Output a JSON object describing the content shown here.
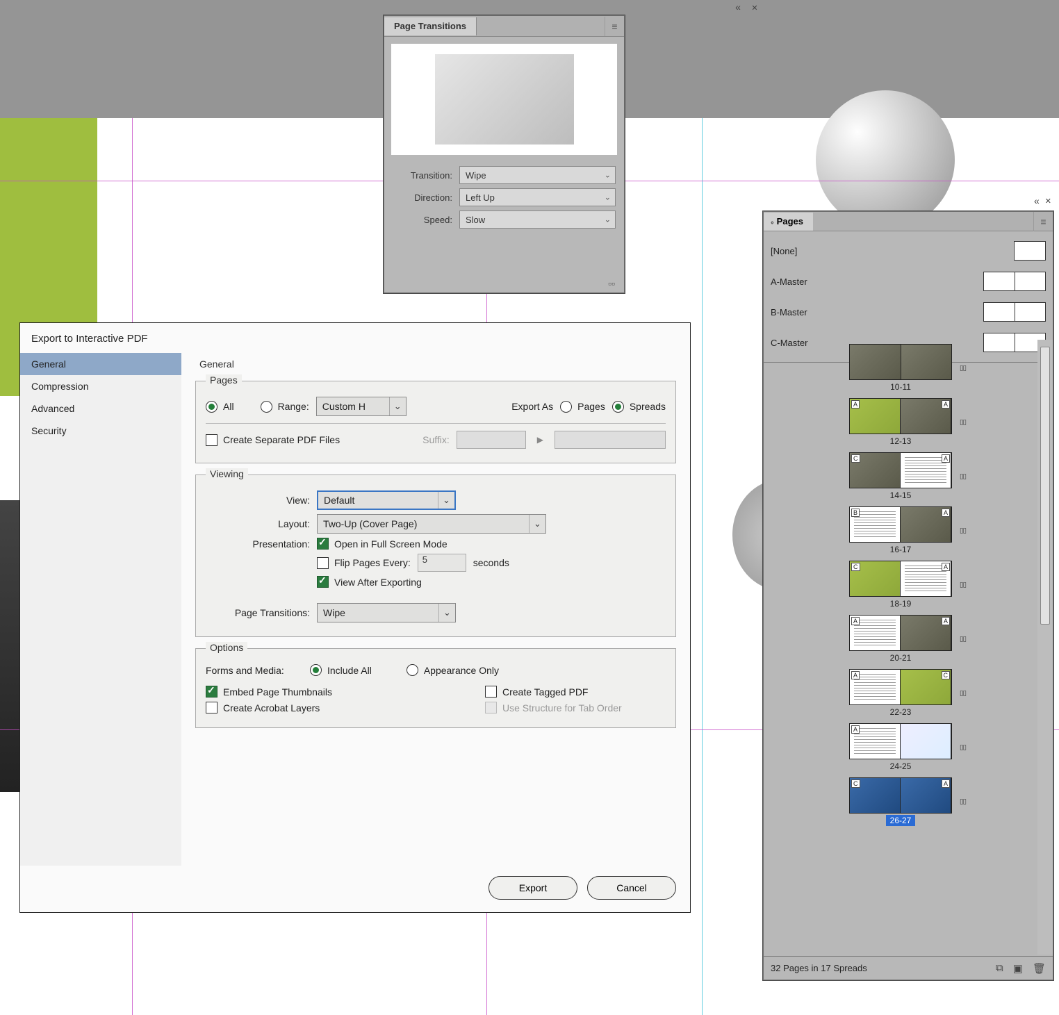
{
  "top_icons": {
    "collapse": "«",
    "close": "✕"
  },
  "page_transitions": {
    "title": "Page Transitions",
    "fields": {
      "transition_label": "Transition:",
      "transition_value": "Wipe",
      "direction_label": "Direction:",
      "direction_value": "Left Up",
      "speed_label": "Speed:",
      "speed_value": "Slow"
    }
  },
  "pages_panel": {
    "title": "Pages",
    "masters": [
      {
        "name": "[None]",
        "double": false
      },
      {
        "name": "A-Master",
        "double": true
      },
      {
        "name": "B-Master",
        "double": true
      },
      {
        "name": "C-Master",
        "double": true
      }
    ],
    "spreads": [
      {
        "label": "10-11",
        "ml": "",
        "mr": "",
        "scheme": [
          "photo",
          "photo"
        ],
        "selected": false
      },
      {
        "label": "12-13",
        "ml": "A",
        "mr": "A",
        "scheme": [
          "green",
          "photo"
        ],
        "selected": false
      },
      {
        "label": "14-15",
        "ml": "C",
        "mr": "A",
        "scheme": [
          "photo",
          "lines"
        ],
        "selected": false
      },
      {
        "label": "16-17",
        "ml": "B",
        "mr": "A",
        "scheme": [
          "lines",
          "photo"
        ],
        "selected": false
      },
      {
        "label": "18-19",
        "ml": "C",
        "mr": "A",
        "scheme": [
          "green",
          "lines"
        ],
        "selected": false
      },
      {
        "label": "20-21",
        "ml": "A",
        "mr": "A",
        "scheme": [
          "lines",
          "photo"
        ],
        "selected": false
      },
      {
        "label": "22-23",
        "ml": "A",
        "mr": "C",
        "scheme": [
          "lines",
          "green"
        ],
        "selected": false
      },
      {
        "label": "24-25",
        "ml": "A",
        "mr": "",
        "scheme": [
          "lines",
          "map"
        ],
        "selected": false
      },
      {
        "label": "26-27",
        "ml": "C",
        "mr": "A",
        "scheme": [
          "blue",
          "blue"
        ],
        "selected": true
      }
    ],
    "footer": "32 Pages in 17 Spreads"
  },
  "export_dialog": {
    "title": "Export to Interactive PDF",
    "sidebar": [
      "General",
      "Compression",
      "Advanced",
      "Security"
    ],
    "active_sidebar_index": 0,
    "content_title": "General",
    "pages_group": {
      "legend": "Pages",
      "all_label": "All",
      "range_label": "Range:",
      "range_value": "Custom H",
      "export_as_label": "Export As",
      "pages_radio": "Pages",
      "spreads_radio": "Spreads",
      "selected_scope": "all",
      "selected_exportas": "spreads",
      "separate_label": "Create Separate PDF Files",
      "suffix_label": "Suffix:"
    },
    "viewing_group": {
      "legend": "Viewing",
      "view_label": "View:",
      "view_value": "Default",
      "layout_label": "Layout:",
      "layout_value": "Two-Up (Cover Page)",
      "presentation_label": "Presentation:",
      "fullscreen_label": "Open in Full Screen Mode",
      "fullscreen_checked": true,
      "flip_label": "Flip Pages Every:",
      "flip_value": "5",
      "seconds_label": "seconds",
      "viewafter_label": "View After Exporting",
      "viewafter_checked": true,
      "pagetrans_label": "Page Transitions:",
      "pagetrans_value": "Wipe"
    },
    "options_group": {
      "legend": "Options",
      "forms_label": "Forms and Media:",
      "include_all": "Include All",
      "appearance_only": "Appearance Only",
      "selected_forms": "include",
      "embed_thumbs": "Embed Page Thumbnails",
      "embed_thumbs_checked": true,
      "tagged_pdf": "Create Tagged PDF",
      "tagged_pdf_checked": false,
      "acrobat_layers": "Create Acrobat Layers",
      "acrobat_layers_checked": false,
      "structure_tab": "Use Structure for Tab Order"
    },
    "buttons": {
      "export": "Export",
      "cancel": "Cancel"
    }
  }
}
